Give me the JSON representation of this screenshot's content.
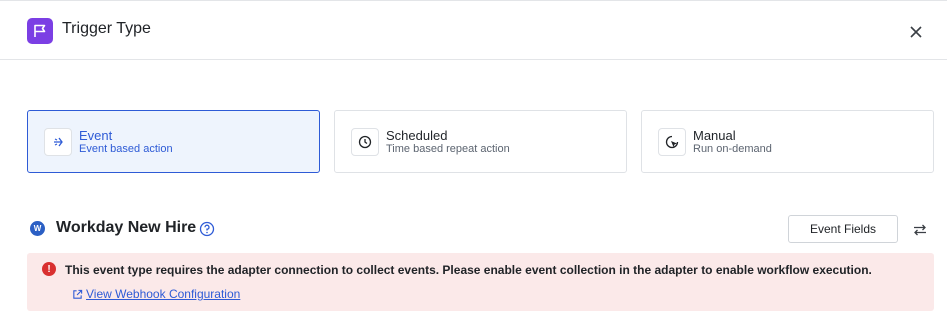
{
  "header": {
    "title": "Trigger Type",
    "icon": "flag-icon",
    "icon_color": "#7b3fe4",
    "close_icon": "close-icon"
  },
  "trigger_types": [
    {
      "title": "Event",
      "subtitle": "Event based action",
      "icon": "event-icon",
      "selected": true
    },
    {
      "title": "Scheduled",
      "subtitle": "Time based repeat action",
      "icon": "clock-icon",
      "selected": false
    },
    {
      "title": "Manual",
      "subtitle": "Run on-demand",
      "icon": "pointer-icon",
      "selected": false
    }
  ],
  "section": {
    "logo_letter": "W",
    "title": "Workday New Hire",
    "help_icon": "help-icon",
    "event_fields_label": "Event Fields",
    "swap_icon": "swap-icon"
  },
  "alert": {
    "icon": "!",
    "message": "This event type requires the adapter connection to collect events. Please enable event collection in the adapter to enable workflow execution.",
    "link_label": "View Webhook Configuration",
    "link_icon": "external-link-icon",
    "background": "#fbe9e9",
    "icon_color": "#d93030"
  },
  "colors": {
    "accent": "#2e5bd6",
    "selected_card_bg": "#eef4fd"
  }
}
